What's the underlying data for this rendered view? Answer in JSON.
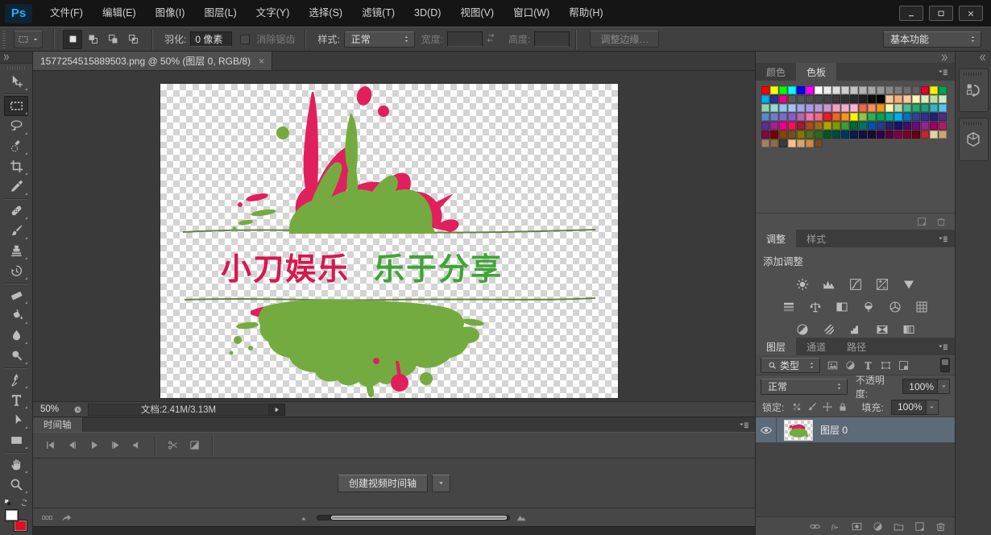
{
  "colors": {
    "accent_blue": "#31a8ff",
    "background_chip_red": "#dd1021",
    "selected_layer_row": "#5d6a77",
    "art_pink": "#e11f5c",
    "art_green": "#74ab40",
    "art_line": "#5a7532",
    "art_text_pink": "#d8174f",
    "art_text_green": "#3fa436"
  },
  "titlebar": {
    "logo": "Ps",
    "menus": [
      "文件(F)",
      "编辑(E)",
      "图像(I)",
      "图层(L)",
      "文字(Y)",
      "选择(S)",
      "滤镜(T)",
      "3D(D)",
      "视图(V)",
      "窗口(W)",
      "帮助(H)"
    ]
  },
  "optionsbar": {
    "modes": [
      "new-selection-icon",
      "add-selection-icon",
      "subtract-selection-icon",
      "intersect-selection-icon"
    ],
    "feather_label": "羽化:",
    "feather_value": "0 像素",
    "antialias_label": "消除锯齿",
    "style_label": "样式:",
    "style_value": "正常",
    "width_label": "宽度:",
    "height_label": "高度:",
    "refine_edge_label": "调整边缘…",
    "workspace": "基本功能"
  },
  "toolbar": {
    "tools": [
      {
        "name": "move-tool"
      },
      {
        "sep": true
      },
      {
        "name": "rectangular-marquee-tool",
        "selected": true
      },
      {
        "name": "lasso-tool"
      },
      {
        "name": "quick-selection-tool"
      },
      {
        "name": "crop-tool"
      },
      {
        "name": "eyedropper-tool"
      },
      {
        "sep": true
      },
      {
        "name": "spot-healing-brush-tool"
      },
      {
        "name": "brush-tool"
      },
      {
        "name": "clone-stamp-tool"
      },
      {
        "name": "history-brush-tool"
      },
      {
        "sep": true
      },
      {
        "name": "eraser-tool"
      },
      {
        "name": "paint-bucket-tool"
      },
      {
        "name": "blur-tool"
      },
      {
        "name": "dodge-tool"
      },
      {
        "sep": true
      },
      {
        "name": "pen-tool"
      },
      {
        "name": "type-tool"
      },
      {
        "name": "path-selection-tool"
      },
      {
        "name": "rectangle-tool"
      },
      {
        "sep": true
      },
      {
        "name": "hand-tool"
      },
      {
        "name": "zoom-tool"
      }
    ]
  },
  "document": {
    "tab_title": "1577254515889503.png @ 50% (图层 0, RGB/8)",
    "close_glyph": "×",
    "zoom_level": "50%",
    "doc_info": "文档:2.41M/3.13M"
  },
  "artwork": {
    "text_left": "小刀娱乐",
    "text_right": "乐于分享"
  },
  "swatches_panel": {
    "tabs": [
      "颜色",
      "色板"
    ],
    "active_tab": "色板",
    "rows": [
      [
        "#ff0000",
        "#ffff00",
        "#00ff00",
        "#00ffff",
        "#0000ff",
        "#ff00ff",
        "#ffffff",
        "#ececec",
        "#dedede",
        "#d0d0d0",
        "#c2c2c2",
        "#b4b4b4",
        "#a6a6a6",
        "#989898",
        "#8a8a8a",
        "#7c7c7c",
        "#6e6e6e",
        "#606060",
        "#e4002b",
        "#fff200",
        "#00a651"
      ],
      [
        "#00aeef",
        "#2e3192",
        "#ec008c",
        "#5a5a5a",
        "#545454",
        "#4e4e4e",
        "#484848",
        "#424242",
        "#3a3a3a",
        "#323232",
        "#2a2a2a",
        "#1f1f1f",
        "#0f0f0f",
        "#000000",
        "#f9c499",
        "#f6b079",
        "#fbc9a2",
        "#fdf5b0",
        "#dcebbb",
        "#bfdfa5",
        "#cdebc4"
      ],
      [
        "#8fd4ae",
        "#9adcc8",
        "#8ec8f0",
        "#a4c4ee",
        "#a0a8e8",
        "#a89ce0",
        "#b49cd8",
        "#c698d0",
        "#f0a0c4",
        "#f4accc",
        "#f8b8d4",
        "#f26649",
        "#f68e56",
        "#f7941d",
        "#fff9ae",
        "#b5dca5",
        "#4dbd8d",
        "#2aa670",
        "#1f9e78",
        "#35b5c1",
        "#52c6e8"
      ],
      [
        "#5b8ac5",
        "#6a7fc9",
        "#7a6cc8",
        "#8a5cc8",
        "#b466ae",
        "#f473b0",
        "#ef6a81",
        "#ed1c24",
        "#f26522",
        "#f7941d",
        "#fff200",
        "#8dc63f",
        "#2bb34b",
        "#00a651",
        "#00a99d",
        "#00aeef",
        "#0072bc",
        "#27488f",
        "#2e3192",
        "#1c2674",
        "#4b2e83"
      ],
      [
        "#5c2d91",
        "#a3238e",
        "#ec008c",
        "#ed145b",
        "#9e1b32",
        "#a54d1f",
        "#9e6b1e",
        "#b5a300",
        "#7a9e00",
        "#3f9c35",
        "#006838",
        "#00746b",
        "#0054a6",
        "#2a3990",
        "#262262",
        "#1b1464",
        "#440e62",
        "#660d74",
        "#92278f",
        "#9e005d",
        "#aa1e6e"
      ],
      [
        "#7b0c3f",
        "#790000",
        "#8a4500",
        "#754c24",
        "#827700",
        "#556b1f",
        "#2a6b24",
        "#005826",
        "#004a3f",
        "#003663",
        "#0d1b4b",
        "#14103d",
        "#1a0a33",
        "#32004b",
        "#56003d",
        "#7b0046",
        "#7a0026",
        "#640010",
        "#c1272d",
        "#e6d3a3",
        "#c6a875"
      ],
      [
        "#a08263",
        "#8a6e4b",
        "#3a3a3a",
        "#f2c28f",
        "#d8a36c",
        "#c98d4e",
        "#754c24"
      ]
    ],
    "foot_icons": [
      "new-swatch-icon",
      "delete-swatch-icon"
    ]
  },
  "adjustments_panel": {
    "tabs": [
      "调整",
      "样式"
    ],
    "active_tab": "调整",
    "hint": "添加调整",
    "rows": [
      [
        "brightness-contrast-icon",
        "levels-icon",
        "curves-icon",
        "exposure-icon",
        "vibrance-icon"
      ],
      [
        "hue-saturation-icon",
        "color-balance-icon",
        "black-white-icon",
        "photo-filter-icon",
        "channel-mixer-icon",
        "color-lookup-icon"
      ],
      [
        "invert-icon",
        "posterize-icon",
        "threshold-icon",
        "gradient-map-icon",
        "selective-color-icon"
      ]
    ]
  },
  "layers_panel": {
    "tabs": [
      "图层",
      "通道",
      "路径"
    ],
    "active_tab": "图层",
    "kind_value": "类型",
    "filter_icons": [
      "image-filter-icon",
      "adjustment-filter-icon",
      "type-filter-icon",
      "shape-filter-icon",
      "smartobject-filter-icon"
    ],
    "blend_mode": "正常",
    "opacity_label": "不透明度:",
    "opacity_value": "100%",
    "lock_label": "锁定:",
    "lock_icons": [
      "lock-transparent-icon",
      "lock-pixels-icon",
      "lock-position-icon",
      "lock-all-icon"
    ],
    "fill_label": "填充:",
    "fill_value": "100%",
    "layer_name": "图层 0",
    "bottom_icons": [
      "link-layers-icon",
      "layer-style-icon",
      "layer-mask-icon",
      "new-adjustment-icon",
      "new-group-icon",
      "new-layer-icon",
      "delete-layer-icon"
    ]
  },
  "timeline": {
    "tab": "时间轴",
    "playback_icons": [
      "first-frame-icon",
      "previous-frame-icon",
      "play-icon",
      "next-frame-icon",
      "audio-icon"
    ],
    "tool_icons": [
      "scissors-icon",
      "transition-icon"
    ],
    "create_button": "创建视频时间轴",
    "bottom_icons": [
      "timeline-frames-icon",
      "render-video-icon"
    ]
  },
  "dock": {
    "panels": [
      "history-panel-icon",
      "threed-panel-icon"
    ]
  }
}
